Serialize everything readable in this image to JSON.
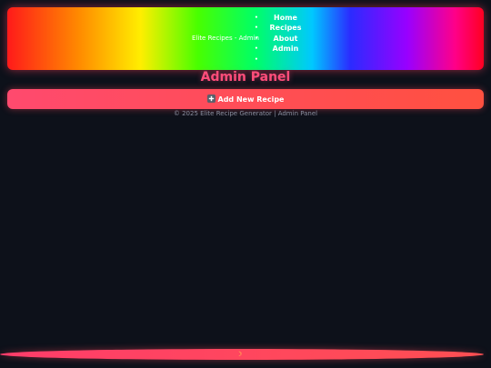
{
  "header": {
    "brand": "Elite Recipes - Admin",
    "nav": [
      {
        "label": "Home"
      },
      {
        "label": "Recipes"
      },
      {
        "label": "About"
      },
      {
        "label": "Admin"
      },
      {
        "label": ""
      }
    ]
  },
  "main": {
    "title": "Admin Panel",
    "add_button_label": "Add New Recipe"
  },
  "footer": {
    "text": "© 2025 Elite Recipe Generator | Admin Panel"
  },
  "bottom_bar": {
    "icon": "moon-icon",
    "glyph": "☽"
  },
  "colors": {
    "background": "#0d111a",
    "accent": "#ff4d7a",
    "button": "#ff4f5a",
    "footer_text": "#8a8fa0"
  }
}
